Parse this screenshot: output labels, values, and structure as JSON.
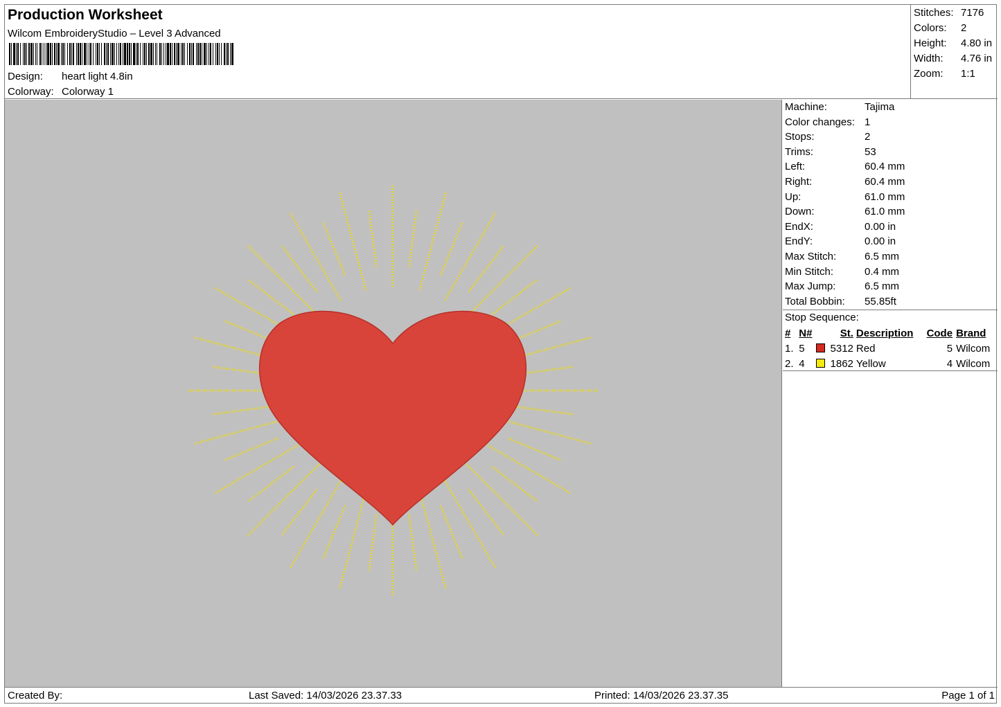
{
  "header": {
    "title": "Production Worksheet",
    "subtitle": "Wilcom EmbroideryStudio – Level 3 Advanced",
    "design_label": "Design:",
    "design_value": "heart light 4.8in",
    "colorway_label": "Colorway:",
    "colorway_value": "Colorway 1"
  },
  "summary": [
    {
      "label": "Stitches:",
      "value": "7176"
    },
    {
      "label": "Colors:",
      "value": "2"
    },
    {
      "label": "Height:",
      "value": "4.80 in"
    },
    {
      "label": "Width:",
      "value": "4.76 in"
    },
    {
      "label": "Zoom:",
      "value": "1:1"
    }
  ],
  "properties": [
    {
      "label": "Machine:",
      "value": "Tajima"
    },
    {
      "label": "Color changes:",
      "value": "1"
    },
    {
      "label": "Stops:",
      "value": "2"
    },
    {
      "label": "Trims:",
      "value": "53"
    },
    {
      "label": "Left:",
      "value": "60.4 mm"
    },
    {
      "label": "Right:",
      "value": "60.4 mm"
    },
    {
      "label": "Up:",
      "value": "61.0 mm"
    },
    {
      "label": "Down:",
      "value": "61.0 mm"
    },
    {
      "label": "EndX:",
      "value": "0.00 in"
    },
    {
      "label": "EndY:",
      "value": "0.00 in"
    },
    {
      "label": "Max Stitch:",
      "value": "6.5 mm"
    },
    {
      "label": "Min Stitch:",
      "value": "0.4 mm"
    },
    {
      "label": "Max Jump:",
      "value": "6.5 mm"
    },
    {
      "label": "Total Bobbin:",
      "value": "55.85ft"
    }
  ],
  "stop_sequence": {
    "title": "Stop Sequence:",
    "columns": {
      "num": "#",
      "n": "N#",
      "st": "St.",
      "description": "Description",
      "code": "Code",
      "brand": "Brand"
    },
    "rows": [
      {
        "num": "1.",
        "n": "5",
        "color": "#d42a20",
        "st": "5312",
        "description": "Red",
        "code": "5",
        "brand": "Wilcom"
      },
      {
        "num": "2.",
        "n": "4",
        "color": "#f5ea10",
        "st": "1862",
        "description": "Yellow",
        "code": "4",
        "brand": "Wilcom"
      }
    ]
  },
  "design": {
    "background": "#c0c0c0",
    "heart_color": "#d9443a",
    "ray_color": "#e3d437"
  },
  "footer": {
    "created": "Created By:",
    "saved": "Last Saved: 14/03/2026 23.37.33",
    "printed": "Printed: 14/03/2026 23.37.35",
    "page": "Page 1 of 1"
  }
}
